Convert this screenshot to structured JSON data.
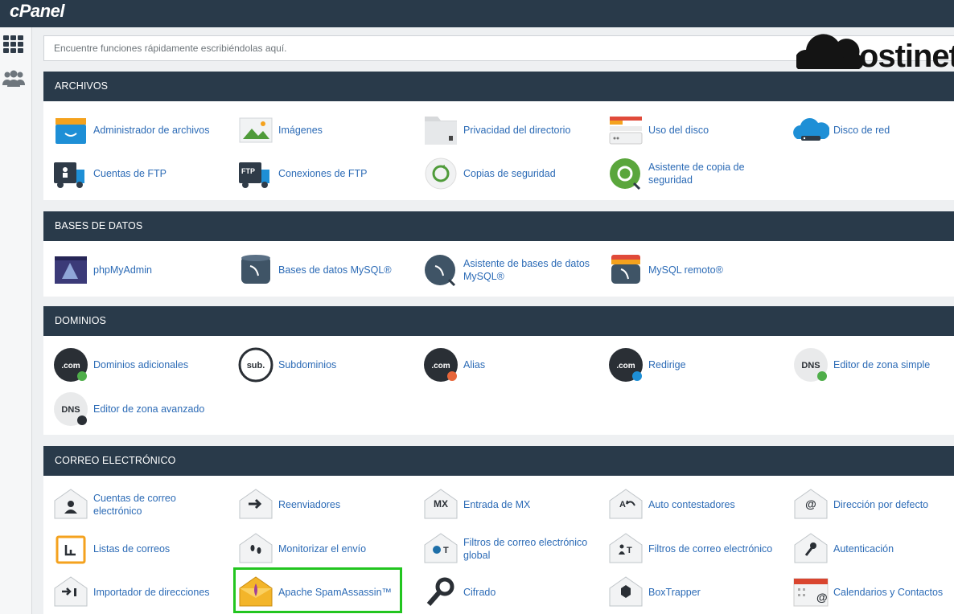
{
  "app": {
    "logo": "cPanel",
    "brand": "Hostinet"
  },
  "search": {
    "placeholder": "Encuentre funciones rápidamente escribiéndolas aquí."
  },
  "sections": [
    {
      "title": "ARCHIVOS",
      "items": [
        {
          "label": "Administrador de archivos",
          "icon": "file-manager-icon"
        },
        {
          "label": "Imágenes",
          "icon": "images-icon"
        },
        {
          "label": "Privacidad del directorio",
          "icon": "directory-privacy-icon"
        },
        {
          "label": "Uso del disco",
          "icon": "disk-usage-icon"
        },
        {
          "label": "Disco de red",
          "icon": "web-disk-icon"
        },
        {
          "label": "Cuentas de FTP",
          "icon": "ftp-accounts-icon"
        },
        {
          "label": "Conexiones de FTP",
          "icon": "ftp-connections-icon"
        },
        {
          "label": "Copias de seguridad",
          "icon": "backup-icon"
        },
        {
          "label": "Asistente de copia de seguridad",
          "icon": "backup-wizard-icon"
        }
      ]
    },
    {
      "title": "BASES DE DATOS",
      "items": [
        {
          "label": "phpMyAdmin",
          "icon": "phpmyadmin-icon"
        },
        {
          "label": "Bases de datos MySQL®",
          "icon": "mysql-databases-icon"
        },
        {
          "label": "Asistente de bases de datos MySQL®",
          "icon": "mysql-wizard-icon"
        },
        {
          "label": "MySQL remoto®",
          "icon": "remote-mysql-icon"
        }
      ]
    },
    {
      "title": "DOMINIOS",
      "items": [
        {
          "label": "Dominios adicionales",
          "icon": "addon-domains-icon",
          "text": ".com"
        },
        {
          "label": "Subdominios",
          "icon": "subdomains-icon",
          "text": "sub."
        },
        {
          "label": "Alias",
          "icon": "aliases-icon",
          "text": ".com"
        },
        {
          "label": "Redirige",
          "icon": "redirects-icon",
          "text": ".com"
        },
        {
          "label": "Editor de zona simple",
          "icon": "simple-zone-editor-icon",
          "text": "DNS"
        },
        {
          "label": "Editor de zona avanzado",
          "icon": "advanced-zone-editor-icon",
          "text": "DNS"
        }
      ]
    },
    {
      "title": "CORREO ELECTRÓNICO",
      "items": [
        {
          "label": "Cuentas de correo electrónico",
          "icon": "email-accounts-icon"
        },
        {
          "label": "Reenviadores",
          "icon": "forwarders-icon"
        },
        {
          "label": "Entrada de MX",
          "icon": "mx-entry-icon",
          "text": "MX"
        },
        {
          "label": "Auto contestadores",
          "icon": "autoresponders-icon"
        },
        {
          "label": "Dirección por defecto",
          "icon": "default-address-icon"
        },
        {
          "label": "Listas de correos",
          "icon": "mailing-lists-icon"
        },
        {
          "label": "Monitorizar el envío",
          "icon": "track-delivery-icon"
        },
        {
          "label": "Filtros de correo electrónico global",
          "icon": "global-email-filters-icon"
        },
        {
          "label": "Filtros de correo electrónico",
          "icon": "email-filters-icon"
        },
        {
          "label": "Autenticación",
          "icon": "authentication-icon"
        },
        {
          "label": "Importador de direcciones",
          "icon": "address-importer-icon"
        },
        {
          "label": "Apache SpamAssassin™",
          "icon": "spamassassin-icon"
        },
        {
          "label": "Cifrado",
          "icon": "encryption-key-icon"
        },
        {
          "label": "BoxTrapper",
          "icon": "boxtrapper-icon"
        },
        {
          "label": "Calendarios y Contactos",
          "icon": "calendars-contacts-icon"
        }
      ]
    }
  ],
  "colors": {
    "header": "#293a4a",
    "link": "#2c6bb6",
    "highlight": "#22c51f"
  }
}
